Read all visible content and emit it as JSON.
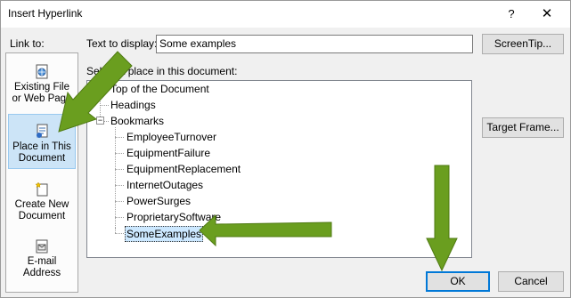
{
  "window": {
    "title": "Insert Hyperlink",
    "help_glyph": "?",
    "close_glyph": "✕"
  },
  "link_to": {
    "label": "Link to:",
    "items": [
      {
        "line1": "Existing File",
        "line2": "or Web Page",
        "icon": "globe-page-icon"
      },
      {
        "line1": "Place in This",
        "line2": "Document",
        "icon": "document-place-icon"
      },
      {
        "line1": "Create New",
        "line2": "Document",
        "icon": "new-document-icon"
      },
      {
        "line1": "E-mail",
        "line2": "Address",
        "icon": "email-icon"
      }
    ],
    "selected_index": 1
  },
  "text_to_display": {
    "label": "Text to display:",
    "value": "Some examples"
  },
  "screentip_button": "ScreenTip...",
  "select_place": {
    "label": "Select a place in this document:",
    "tree": {
      "top": "Top of the Document",
      "headings": "Headings",
      "bookmarks": "Bookmarks",
      "bookmark_items": [
        "EmployeeTurnover",
        "EquipmentFailure",
        "EquipmentReplacement",
        "InternetOutages",
        "PowerSurges",
        "ProprietarySoftware",
        "SomeExamples"
      ],
      "selected": "SomeExamples"
    }
  },
  "target_frame_button": "Target Frame...",
  "ok_button": "OK",
  "cancel_button": "Cancel",
  "colors": {
    "arrow": "#6a9e1f",
    "selection": "#cce8ff",
    "accent": "#0078d7"
  }
}
